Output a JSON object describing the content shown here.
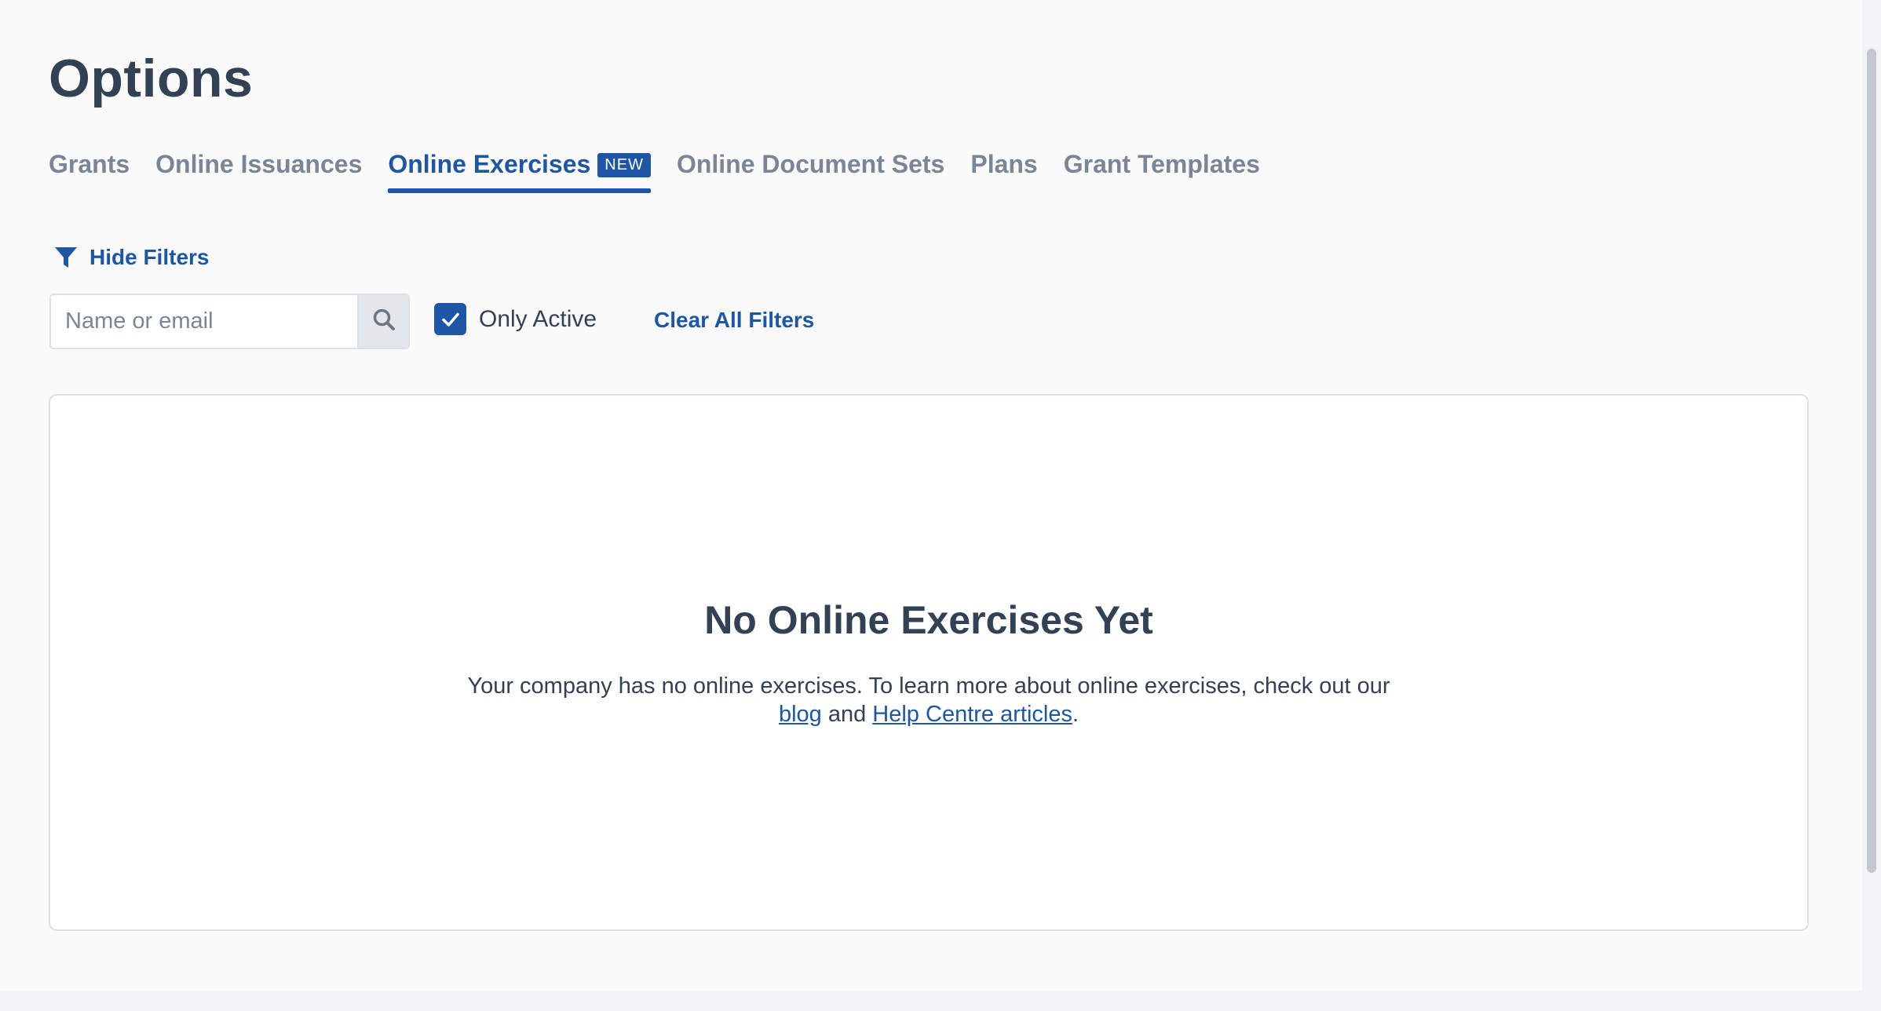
{
  "page": {
    "title": "Options"
  },
  "tabs": [
    {
      "label": "Grants"
    },
    {
      "label": "Online Issuances"
    },
    {
      "label": "Online Exercises",
      "badge": "NEW"
    },
    {
      "label": "Online Document Sets"
    },
    {
      "label": "Plans"
    },
    {
      "label": "Grant Templates"
    }
  ],
  "active_tab": "Online Exercises",
  "filters": {
    "toggle_label": "Hide Filters",
    "search_placeholder": "Name or email",
    "search_value": "",
    "only_active_label": "Only Active",
    "only_active_checked": true,
    "clear_label": "Clear All Filters"
  },
  "empty_state": {
    "title": "No Online Exercises Yet",
    "text_before": "Your company has no online exercises. To learn more about online exercises, check out our ",
    "blog_link": "blog",
    "text_middle": " and ",
    "help_link": "Help Centre articles",
    "text_after": "."
  },
  "colors": {
    "accent": "#1d56a7",
    "text": "#334155",
    "muted": "#7a8697",
    "border": "#dde1e6"
  },
  "icons": {
    "filter": "filter-icon",
    "search": "search-icon",
    "check": "check-icon"
  }
}
